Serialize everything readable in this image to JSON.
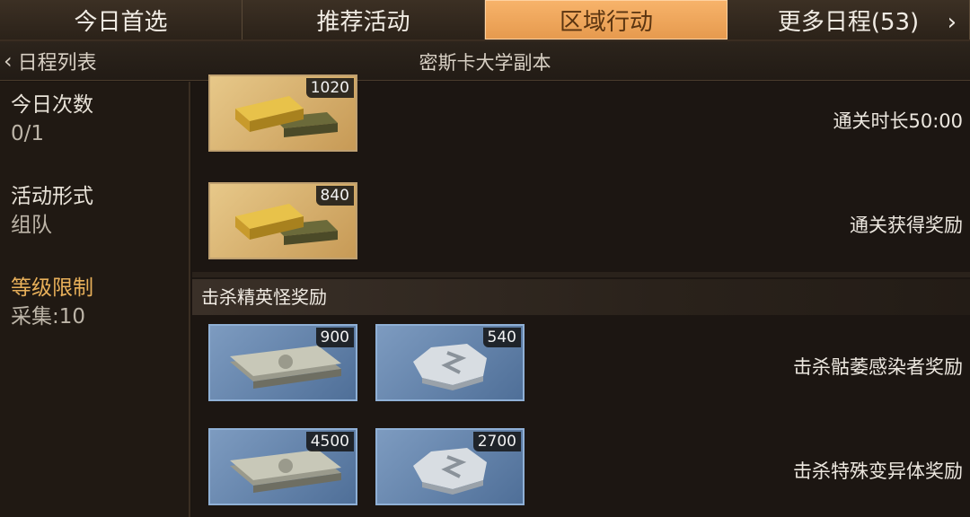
{
  "tabs": [
    {
      "label": "今日首选",
      "active": false
    },
    {
      "label": "推荐活动",
      "active": false
    },
    {
      "label": "区域行动",
      "active": true
    },
    {
      "label": "更多日程(53)",
      "active": false
    }
  ],
  "subheader": {
    "back_label": "日程列表",
    "title": "密斯卡大学副本"
  },
  "info": {
    "daily_label": "今日次数",
    "daily_value": "0/1",
    "form_label": "活动形式",
    "form_value": "组队",
    "level_label": "等级限制",
    "level_value": "采集:10"
  },
  "rewards": {
    "row1": {
      "qty": "1020",
      "desc": "通关时长50:00",
      "icon": "gold-bars-icon"
    },
    "row2": {
      "qty": "840",
      "desc": "通关获得奖励",
      "icon": "gold-bars-icon"
    },
    "section_title": "击杀精英怪奖励",
    "row3": {
      "items": [
        {
          "qty": "900",
          "icon": "cash-stack-icon"
        },
        {
          "qty": "540",
          "icon": "silver-coin-icon"
        }
      ],
      "desc": "击杀骷萎感染者奖励"
    },
    "row4": {
      "items": [
        {
          "qty": "4500",
          "icon": "cash-stack-icon"
        },
        {
          "qty": "2700",
          "icon": "silver-coin-icon"
        }
      ],
      "desc": "击杀特殊变异体奖励"
    }
  },
  "colors": {
    "accent_tab": "#e69a4e",
    "gold_frame": "#bfa070",
    "blue_frame": "#8fb0d6"
  }
}
